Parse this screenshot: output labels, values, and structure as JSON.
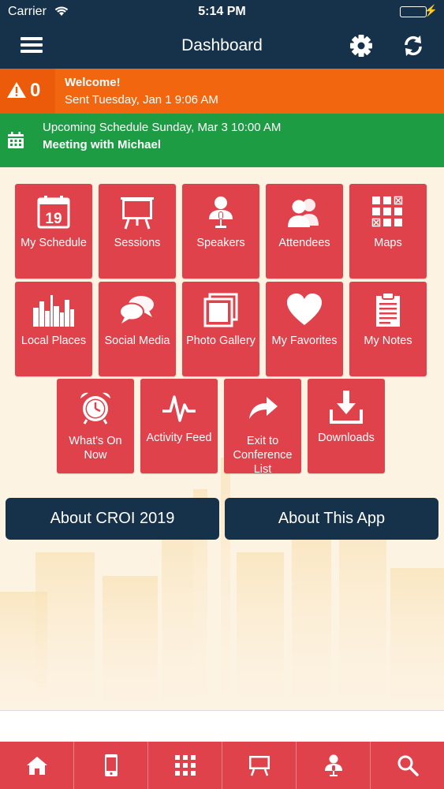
{
  "status_bar": {
    "carrier": "Carrier",
    "time": "5:14 PM"
  },
  "nav": {
    "title": "Dashboard"
  },
  "alert": {
    "count": "0",
    "title": "Welcome!",
    "subtitle": "Sent Tuesday, Jan 1 9:06 AM"
  },
  "schedule": {
    "line1": "Upcoming Schedule Sunday, Mar 3 10:00 AM",
    "line2": "Meeting with Michael"
  },
  "tiles": [
    {
      "label": "My Schedule",
      "icon": "calendar-icon",
      "icon_text": "19"
    },
    {
      "label": "Sessions",
      "icon": "presentation-board-icon"
    },
    {
      "label": "Speakers",
      "icon": "speaker-podium-icon"
    },
    {
      "label": "Attendees",
      "icon": "people-icon"
    },
    {
      "label": "Maps",
      "icon": "map-grid-icon"
    },
    {
      "label": "Local Places",
      "icon": "city-skyline-icon"
    },
    {
      "label": "Social Media",
      "icon": "chat-bubbles-icon"
    },
    {
      "label": "Photo Gallery",
      "icon": "photos-icon"
    },
    {
      "label": "My Favorites",
      "icon": "heart-icon"
    },
    {
      "label": "My Notes",
      "icon": "clipboard-icon"
    },
    {
      "label": "What's On Now",
      "icon": "alarm-clock-icon"
    },
    {
      "label": "Activity Feed",
      "icon": "pulse-icon"
    },
    {
      "label": "Exit to Conference List",
      "icon": "share-arrow-icon"
    },
    {
      "label": "Downloads",
      "icon": "download-tray-icon"
    }
  ],
  "buttons": {
    "about_event": "About CROI 2019",
    "about_app": "About This App"
  },
  "tab_bar": [
    "home-icon",
    "mobile-device-icon",
    "map-grid-icon",
    "presentation-board-icon",
    "speaker-podium-icon",
    "search-icon"
  ],
  "colors": {
    "navy": "#16324a",
    "orange": "#f2660f",
    "green": "#1d9c44",
    "red": "#e0424b",
    "background": "#fdf3e3"
  }
}
